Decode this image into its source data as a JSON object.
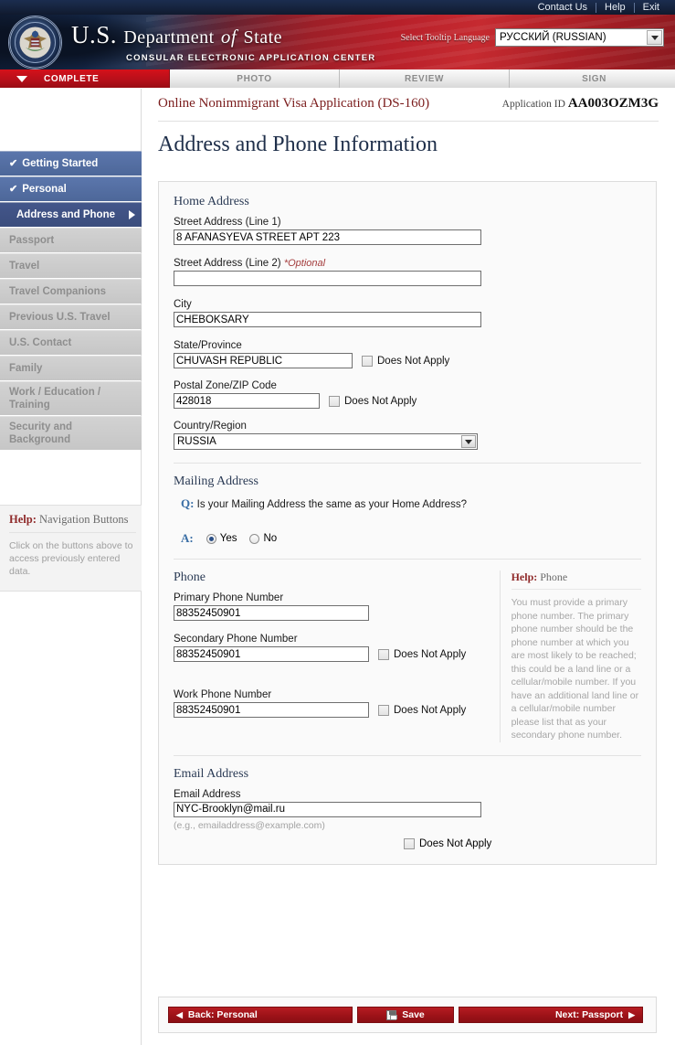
{
  "topnav": {
    "links": [
      "Contact Us",
      "Help",
      "Exit"
    ]
  },
  "banner": {
    "title_us": "U.S.",
    "title_department": "Department",
    "title_of": "of",
    "title_state": "State",
    "subtitle": "CONSULAR ELECTRONIC APPLICATION CENTER",
    "tooltip_language_label": "Select Tooltip Language",
    "tooltip_language_value": "РУССКИЙ (RUSSIAN)",
    "accent_red": "#b8101a",
    "accent_navy": "#16243f"
  },
  "tabs": [
    {
      "label": "COMPLETE",
      "active": true
    },
    {
      "label": "PHOTO",
      "active": false
    },
    {
      "label": "REVIEW",
      "active": false
    },
    {
      "label": "SIGN",
      "active": false
    }
  ],
  "sidebar": {
    "items": [
      {
        "label": "Getting Started",
        "state": "done"
      },
      {
        "label": "Personal",
        "state": "done"
      },
      {
        "label": "Address and Phone",
        "state": "current"
      },
      {
        "label": "Passport",
        "state": "pending"
      },
      {
        "label": "Travel",
        "state": "pending"
      },
      {
        "label": "Travel Companions",
        "state": "pending"
      },
      {
        "label": "Previous U.S. Travel",
        "state": "pending"
      },
      {
        "label": "U.S. Contact",
        "state": "pending"
      },
      {
        "label": "Family",
        "state": "pending"
      },
      {
        "label": "Work / Education / Training",
        "state": "pending"
      },
      {
        "label": "Security and Background",
        "state": "pending"
      }
    ],
    "help": {
      "heading_prefix": "Help:",
      "heading_topic": "Navigation Buttons",
      "text": "Click on the buttons above to access previously entered data."
    }
  },
  "app_header": {
    "form_title": "Online Nonimmigrant Visa Application (DS-160)",
    "application_id_label": "Application ID",
    "application_id_value": "AA003OZM3G"
  },
  "page_title": "Address and Phone Information",
  "home_address": {
    "section_title": "Home Address",
    "street1_label": "Street Address (Line 1)",
    "street1_value": "8 AFANASYEVA STREET APT 223",
    "street2_label": "Street Address (Line 2)",
    "street2_optional": "*Optional",
    "street2_value": "",
    "city_label": "City",
    "city_value": "CHEBOKSARY",
    "state_label": "State/Province",
    "state_value": "CHUVASH REPUBLIC",
    "state_dna_label": "Does Not Apply",
    "state_dna_checked": false,
    "postal_label": "Postal Zone/ZIP Code",
    "postal_value": "428018",
    "postal_dna_label": "Does Not Apply",
    "postal_dna_checked": false,
    "country_label": "Country/Region",
    "country_value": "RUSSIA"
  },
  "mailing_address": {
    "section_title": "Mailing Address",
    "q_marker": "Q:",
    "question": "Is your Mailing Address the same as your Home Address?",
    "a_marker": "A:",
    "yes_label": "Yes",
    "no_label": "No",
    "selected": "Yes"
  },
  "phone": {
    "section_title": "Phone",
    "primary_label": "Primary Phone Number",
    "primary_value": "88352450901",
    "secondary_label": "Secondary Phone Number",
    "secondary_value": "88352450901",
    "secondary_dna_label": "Does Not Apply",
    "secondary_dna_checked": false,
    "work_label": "Work Phone Number",
    "work_value": "88352450901",
    "work_dna_label": "Does Not Apply",
    "work_dna_checked": false,
    "help": {
      "heading_prefix": "Help:",
      "heading_topic": "Phone",
      "text": "You must provide a primary phone number. The primary phone number should be the phone number at which you are most likely to be reached; this could be a land line or a cellular/mobile number. If you have an additional land line or a cellular/mobile number please list that as your secondary phone number."
    }
  },
  "email": {
    "section_title": "Email Address",
    "field_label": "Email Address",
    "value": "NYC-Brooklyn@mail.ru",
    "hint": "(e.g., emailaddress@example.com)",
    "dna_label": "Does Not Apply",
    "dna_checked": false
  },
  "footer": {
    "back_label": "Back: Personal",
    "save_label": "Save",
    "next_label": "Next: Passport",
    "back_arrow": "◀",
    "next_arrow": "▶"
  }
}
